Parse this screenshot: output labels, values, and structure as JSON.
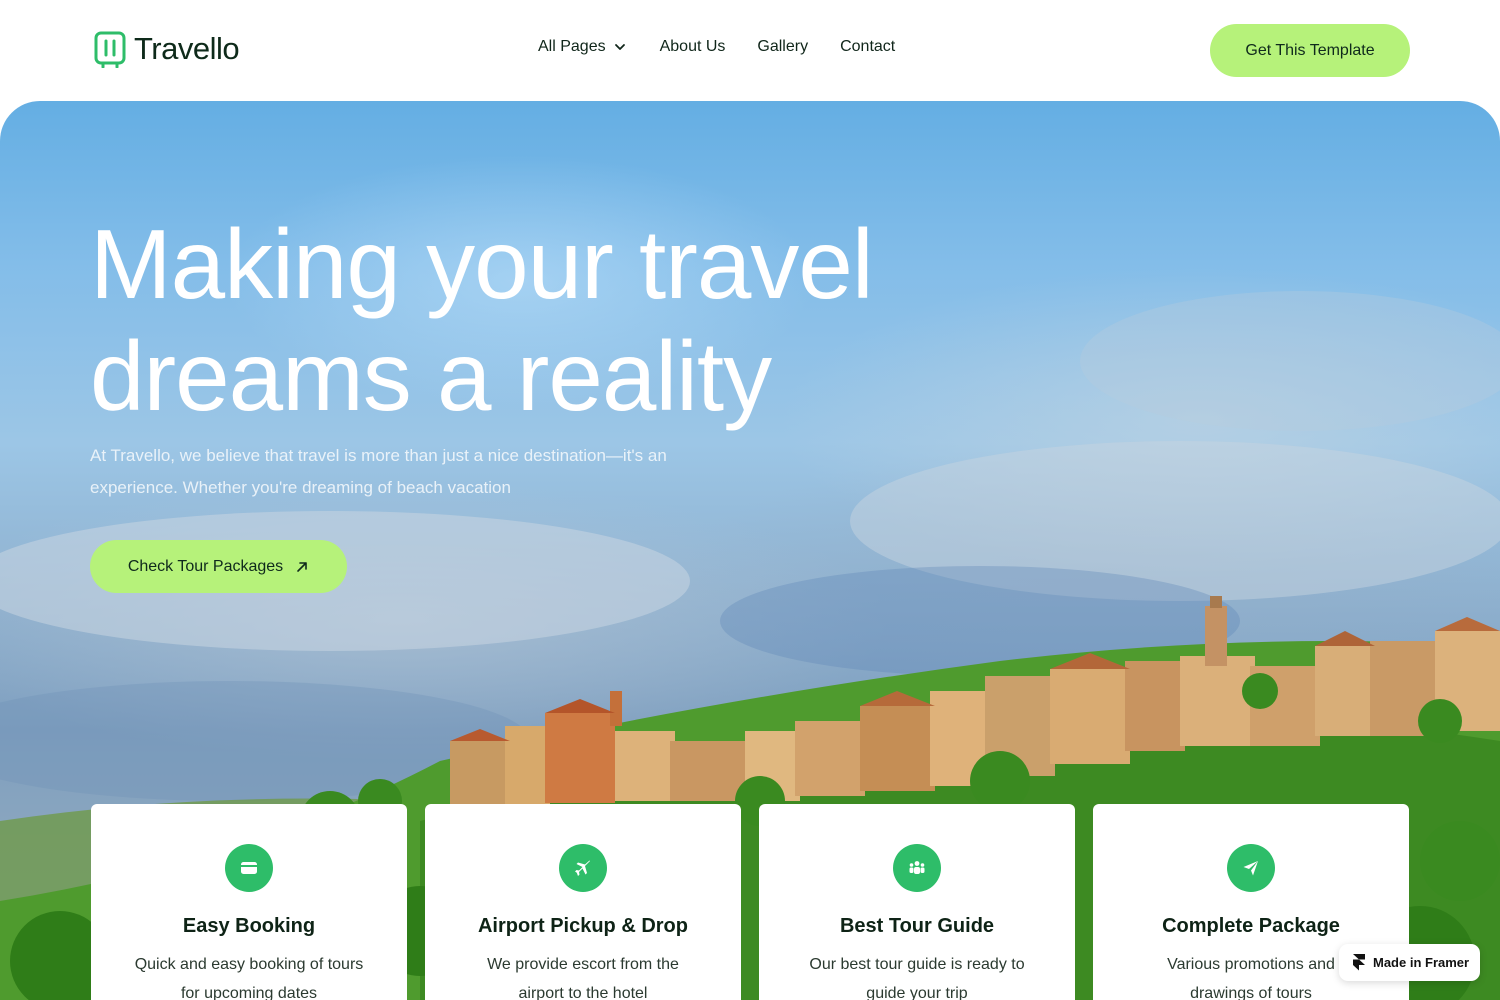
{
  "header": {
    "logo_text": "Travello",
    "nav": [
      {
        "label": "All Pages"
      },
      {
        "label": "About Us"
      },
      {
        "label": "Gallery"
      },
      {
        "label": "Contact"
      }
    ],
    "cta_label": "Get This Template"
  },
  "hero": {
    "title_line1": "Making your travel",
    "title_line2": "dreams a reality",
    "subtitle": "At Travello, we believe that travel is more than just a nice destination—it's an experience. Whether you're dreaming of beach vacation",
    "cta_label": "Check Tour Packages"
  },
  "features": [
    {
      "icon": "credit-card-icon",
      "title": "Easy Booking",
      "desc": "Quick and easy booking of tours for upcoming dates"
    },
    {
      "icon": "airplane-icon",
      "title": "Airport Pickup & Drop",
      "desc": "We provide escort from the airport to the hotel"
    },
    {
      "icon": "users-icon",
      "title": "Best Tour Guide",
      "desc": "Our best tour guide is ready to guide your trip"
    },
    {
      "icon": "paper-plane-icon",
      "title": "Complete Package",
      "desc": "Various promotions and drawings of tours"
    }
  ],
  "badge": {
    "label": "Made in Framer"
  },
  "colors": {
    "accent": "#b6f27a",
    "brand_green": "#2ebd69",
    "sky": "#64aee3"
  }
}
